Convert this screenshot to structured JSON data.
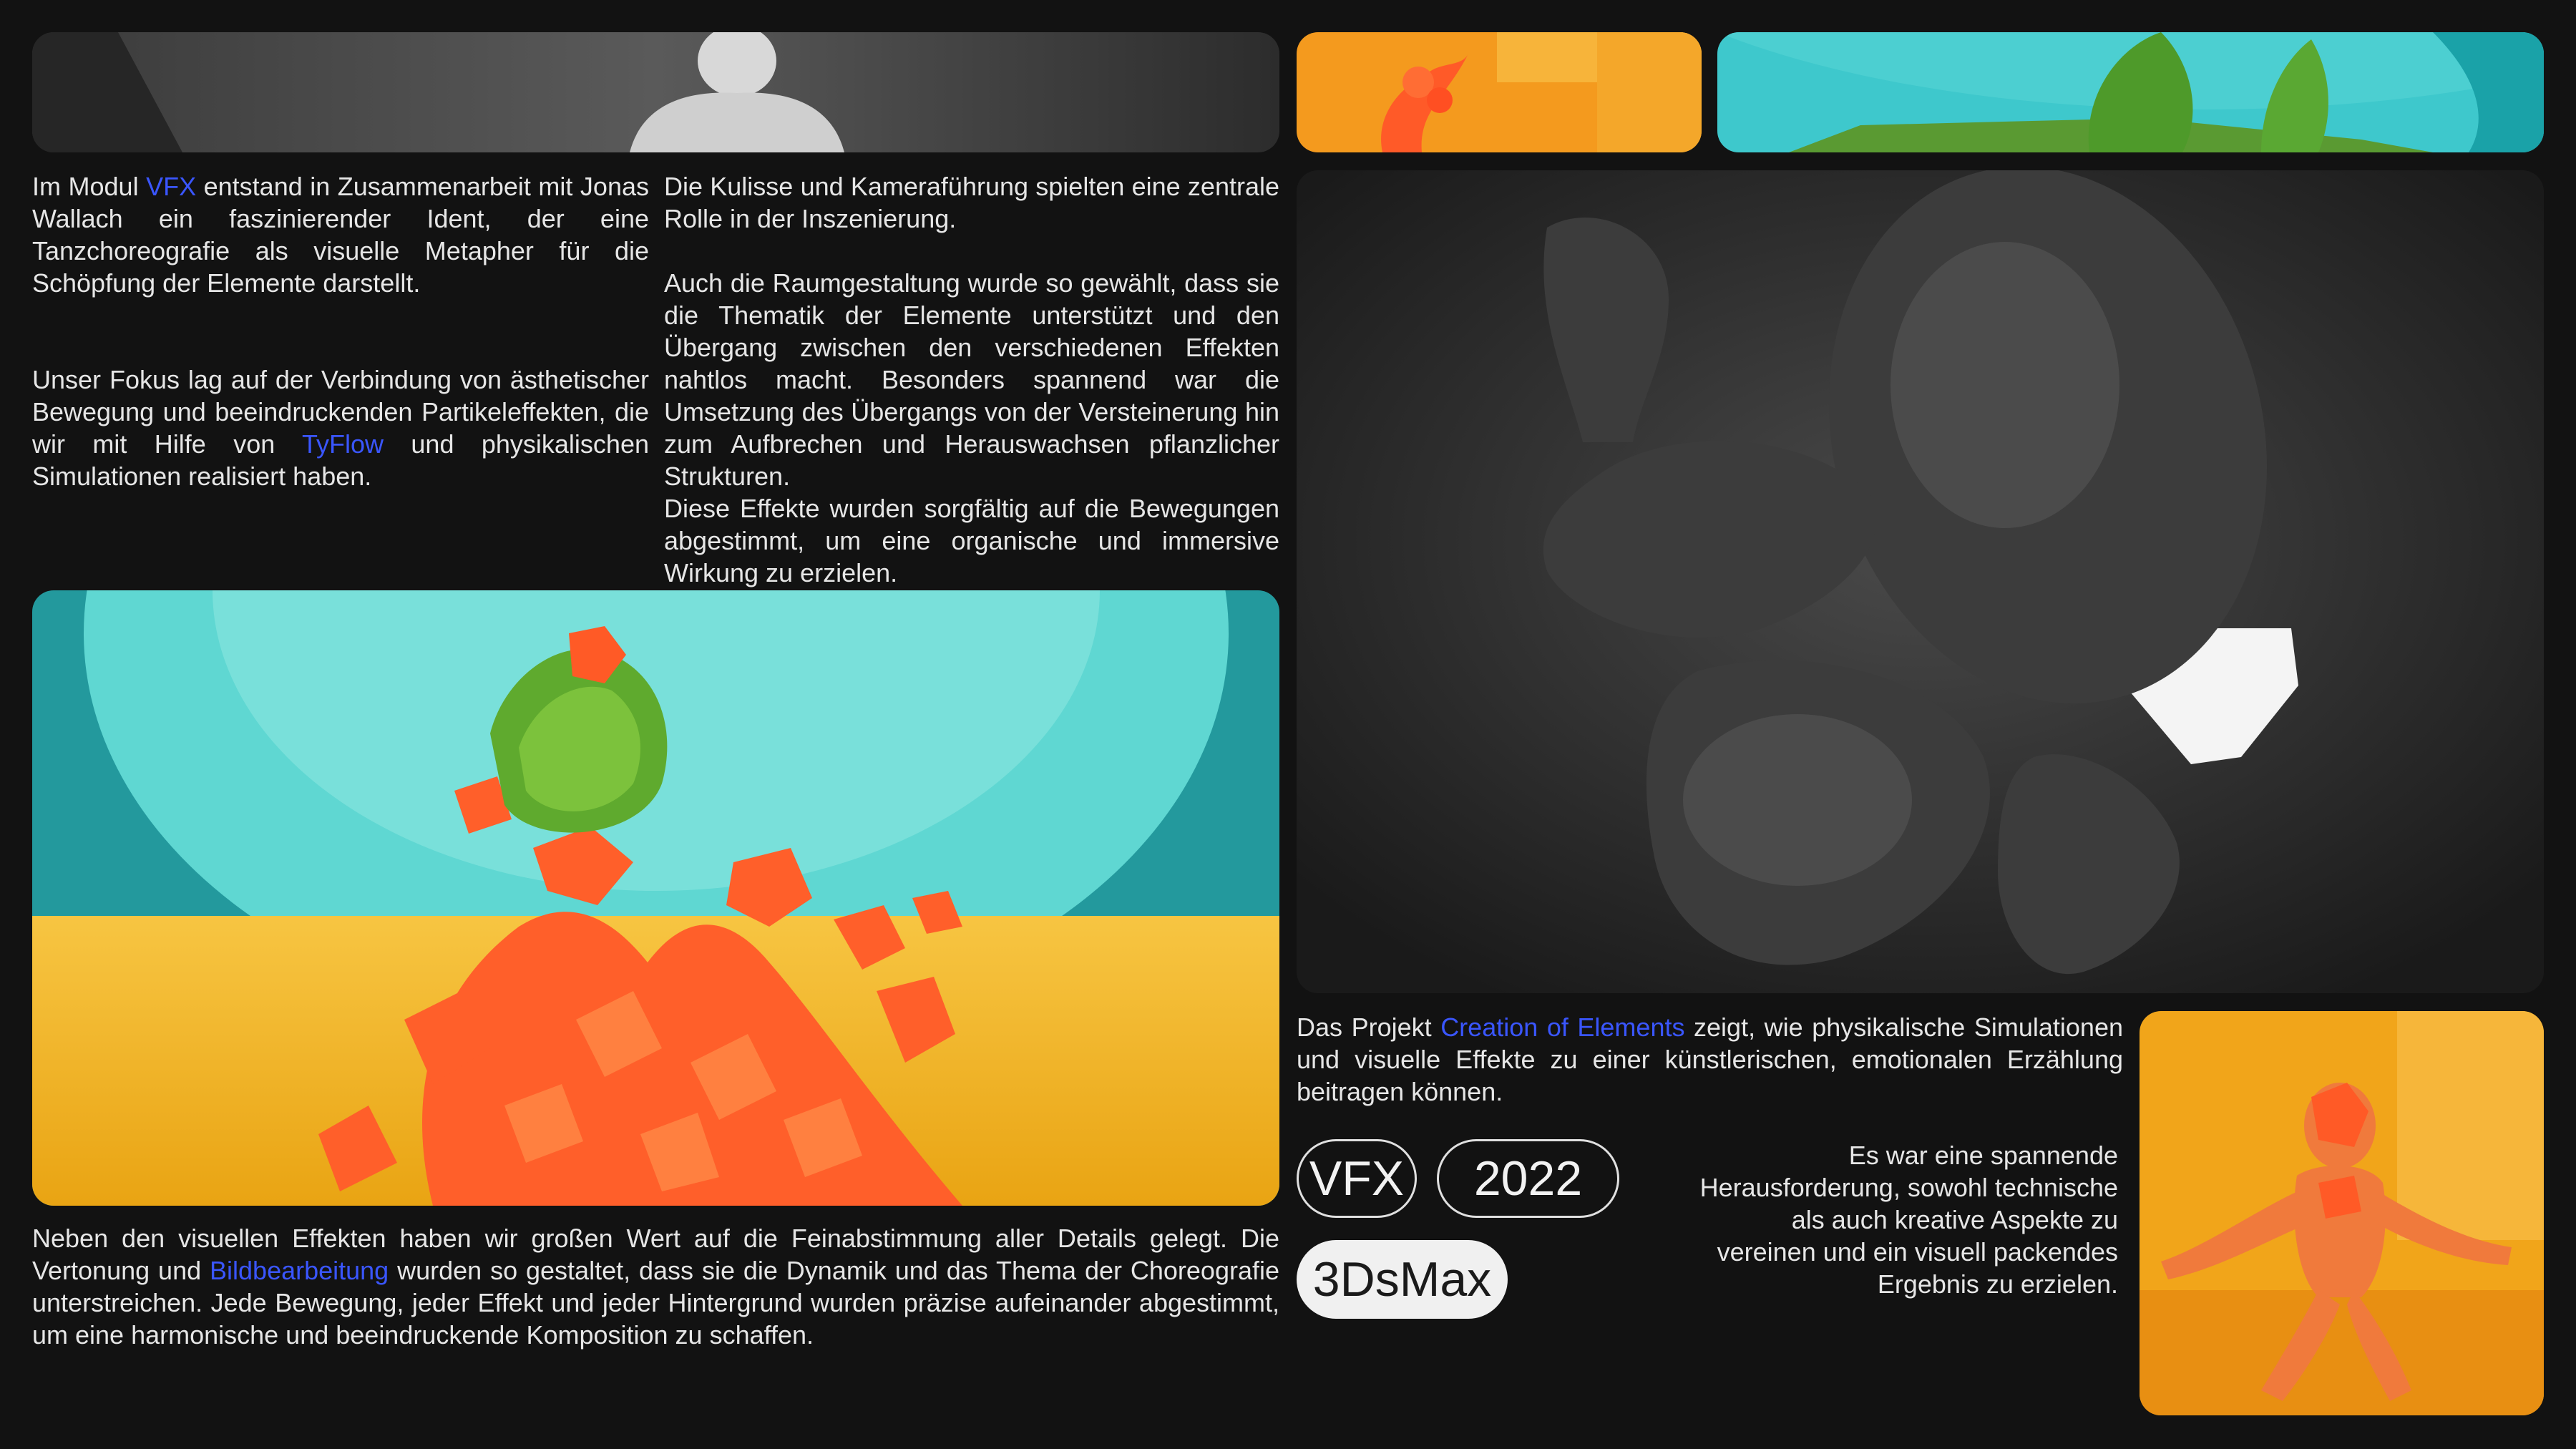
{
  "text": {
    "left_col1_p1": [
      "Im Modul ",
      "VFX",
      " entstand in Zusammenarbeit mit Jonas Wallach ein faszinierender Ident, der eine Tanzchoreografie als visuelle Metapher für die Schöpfung der Elemente darstellt."
    ],
    "left_col1_p2": [
      "Unser Fokus lag auf der Verbindung von ästhetischer Bewegung und beeindruckenden Partikeleffekten, die wir mit Hilfe von ",
      "TyFlow",
      " und physikalischen Simulationen realisiert haben."
    ],
    "left_col2_p1": "Die Kulisse und Kameraführung spielten eine zentrale Rolle in der Inszenierung.",
    "left_col2_p2": "Auch die Raumgestaltung wurde so gewählt, dass sie die Thematik der Elemente unterstützt und den Übergang zwischen den verschiedenen Effekten nahtlos macht. Besonders spannend war die Umsetzung des Übergangs von der Versteinerung hin zum Aufbrechen und Herauswachsen pflanzlicher Strukturen.",
    "left_col2_p3": "Diese Effekte wurden sorgfältig auf die Bewegungen abgestimmt, um eine organische und immersive Wirkung zu erzielen.",
    "bottom_p": [
      "Neben den visuellen Effekten haben wir großen Wert auf die Feinabstimmung aller Details gelegt. Die Vertonung und ",
      "Bildbearbeitung",
      " wurden so gestaltet, dass sie die Dynamik und das Thema der Choreografie unterstreichen. Jede Bewegung, jeder Effekt und jeder Hintergrund wurden präzise aufeinander abgestimmt, um eine harmonische und beeindruckende Komposition zu schaffen."
    ],
    "project_p": [
      "Das Projekt ",
      "Creation of Elements",
      " zeigt, wie physikalische Simulationen und visuelle Effekte zu einer künstlerischen, emotionalen Erzählung beitragen können."
    ],
    "challenge_p": "Es war eine spannende Herausforderung, sowohl technische als auch kreative Aspekte zu vereinen und ein visuell packendes Ergebnis zu erzielen."
  },
  "tags": {
    "vfx": "VFX",
    "year": "2022",
    "software": "3DsMax"
  },
  "colors": {
    "link": "#3a56ff",
    "orange": "#ff6a2b",
    "yellow": "#f0b21a",
    "teal": "#3fc8c8",
    "background": "#121212"
  }
}
